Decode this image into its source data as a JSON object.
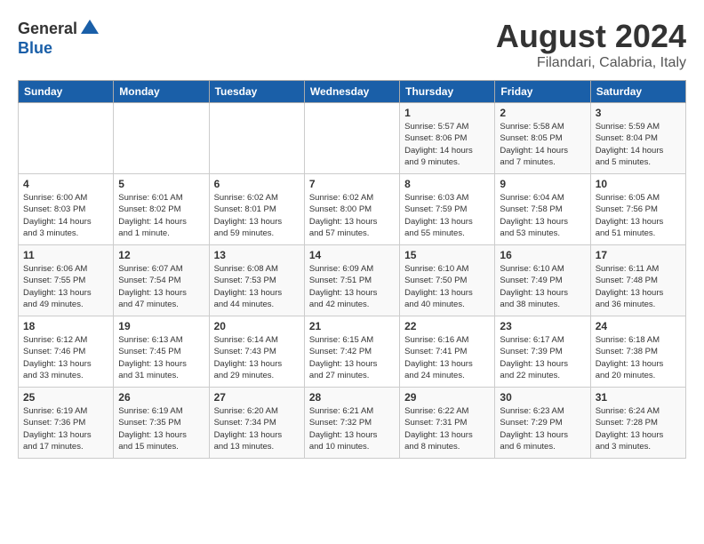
{
  "header": {
    "logo_general": "General",
    "logo_blue": "Blue",
    "month_title": "August 2024",
    "subtitle": "Filandari, Calabria, Italy"
  },
  "days_of_week": [
    "Sunday",
    "Monday",
    "Tuesday",
    "Wednesday",
    "Thursday",
    "Friday",
    "Saturday"
  ],
  "weeks": [
    [
      {
        "day": "",
        "info": ""
      },
      {
        "day": "",
        "info": ""
      },
      {
        "day": "",
        "info": ""
      },
      {
        "day": "",
        "info": ""
      },
      {
        "day": "1",
        "info": "Sunrise: 5:57 AM\nSunset: 8:06 PM\nDaylight: 14 hours\nand 9 minutes."
      },
      {
        "day": "2",
        "info": "Sunrise: 5:58 AM\nSunset: 8:05 PM\nDaylight: 14 hours\nand 7 minutes."
      },
      {
        "day": "3",
        "info": "Sunrise: 5:59 AM\nSunset: 8:04 PM\nDaylight: 14 hours\nand 5 minutes."
      }
    ],
    [
      {
        "day": "4",
        "info": "Sunrise: 6:00 AM\nSunset: 8:03 PM\nDaylight: 14 hours\nand 3 minutes."
      },
      {
        "day": "5",
        "info": "Sunrise: 6:01 AM\nSunset: 8:02 PM\nDaylight: 14 hours\nand 1 minute."
      },
      {
        "day": "6",
        "info": "Sunrise: 6:02 AM\nSunset: 8:01 PM\nDaylight: 13 hours\nand 59 minutes."
      },
      {
        "day": "7",
        "info": "Sunrise: 6:02 AM\nSunset: 8:00 PM\nDaylight: 13 hours\nand 57 minutes."
      },
      {
        "day": "8",
        "info": "Sunrise: 6:03 AM\nSunset: 7:59 PM\nDaylight: 13 hours\nand 55 minutes."
      },
      {
        "day": "9",
        "info": "Sunrise: 6:04 AM\nSunset: 7:58 PM\nDaylight: 13 hours\nand 53 minutes."
      },
      {
        "day": "10",
        "info": "Sunrise: 6:05 AM\nSunset: 7:56 PM\nDaylight: 13 hours\nand 51 minutes."
      }
    ],
    [
      {
        "day": "11",
        "info": "Sunrise: 6:06 AM\nSunset: 7:55 PM\nDaylight: 13 hours\nand 49 minutes."
      },
      {
        "day": "12",
        "info": "Sunrise: 6:07 AM\nSunset: 7:54 PM\nDaylight: 13 hours\nand 47 minutes."
      },
      {
        "day": "13",
        "info": "Sunrise: 6:08 AM\nSunset: 7:53 PM\nDaylight: 13 hours\nand 44 minutes."
      },
      {
        "day": "14",
        "info": "Sunrise: 6:09 AM\nSunset: 7:51 PM\nDaylight: 13 hours\nand 42 minutes."
      },
      {
        "day": "15",
        "info": "Sunrise: 6:10 AM\nSunset: 7:50 PM\nDaylight: 13 hours\nand 40 minutes."
      },
      {
        "day": "16",
        "info": "Sunrise: 6:10 AM\nSunset: 7:49 PM\nDaylight: 13 hours\nand 38 minutes."
      },
      {
        "day": "17",
        "info": "Sunrise: 6:11 AM\nSunset: 7:48 PM\nDaylight: 13 hours\nand 36 minutes."
      }
    ],
    [
      {
        "day": "18",
        "info": "Sunrise: 6:12 AM\nSunset: 7:46 PM\nDaylight: 13 hours\nand 33 minutes."
      },
      {
        "day": "19",
        "info": "Sunrise: 6:13 AM\nSunset: 7:45 PM\nDaylight: 13 hours\nand 31 minutes."
      },
      {
        "day": "20",
        "info": "Sunrise: 6:14 AM\nSunset: 7:43 PM\nDaylight: 13 hours\nand 29 minutes."
      },
      {
        "day": "21",
        "info": "Sunrise: 6:15 AM\nSunset: 7:42 PM\nDaylight: 13 hours\nand 27 minutes."
      },
      {
        "day": "22",
        "info": "Sunrise: 6:16 AM\nSunset: 7:41 PM\nDaylight: 13 hours\nand 24 minutes."
      },
      {
        "day": "23",
        "info": "Sunrise: 6:17 AM\nSunset: 7:39 PM\nDaylight: 13 hours\nand 22 minutes."
      },
      {
        "day": "24",
        "info": "Sunrise: 6:18 AM\nSunset: 7:38 PM\nDaylight: 13 hours\nand 20 minutes."
      }
    ],
    [
      {
        "day": "25",
        "info": "Sunrise: 6:19 AM\nSunset: 7:36 PM\nDaylight: 13 hours\nand 17 minutes."
      },
      {
        "day": "26",
        "info": "Sunrise: 6:19 AM\nSunset: 7:35 PM\nDaylight: 13 hours\nand 15 minutes."
      },
      {
        "day": "27",
        "info": "Sunrise: 6:20 AM\nSunset: 7:34 PM\nDaylight: 13 hours\nand 13 minutes."
      },
      {
        "day": "28",
        "info": "Sunrise: 6:21 AM\nSunset: 7:32 PM\nDaylight: 13 hours\nand 10 minutes."
      },
      {
        "day": "29",
        "info": "Sunrise: 6:22 AM\nSunset: 7:31 PM\nDaylight: 13 hours\nand 8 minutes."
      },
      {
        "day": "30",
        "info": "Sunrise: 6:23 AM\nSunset: 7:29 PM\nDaylight: 13 hours\nand 6 minutes."
      },
      {
        "day": "31",
        "info": "Sunrise: 6:24 AM\nSunset: 7:28 PM\nDaylight: 13 hours\nand 3 minutes."
      }
    ]
  ]
}
